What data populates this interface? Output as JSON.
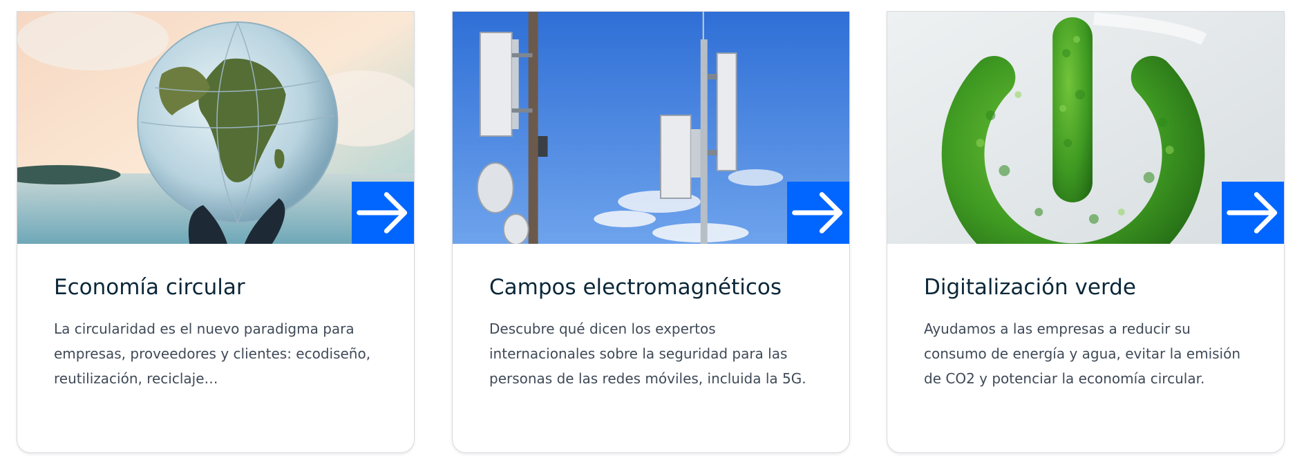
{
  "arrow_icon": "arrow-right-icon",
  "accent_color": "#0066ff",
  "cards": [
    {
      "title": "Economía circular",
      "description": "La circularidad es el nuevo paradigma para empresas, proveedores y clientes: ecodiseño, reutilización, reciclaje…",
      "image": "globe-in-hands-at-sunset"
    },
    {
      "title": "Campos electromagnéticos",
      "description": "Descubre qué dicen los expertos internacionales sobre la seguridad para las personas de las redes móviles, incluida la 5G.",
      "image": "mobile-antenna-towers"
    },
    {
      "title": "Digitalización verde",
      "description": "Ayudamos a las empresas a reducir su consumo de energía y agua, evitar la emisión de CO2 y potenciar la economía circular.",
      "image": "green-leaf-power-symbol"
    }
  ]
}
